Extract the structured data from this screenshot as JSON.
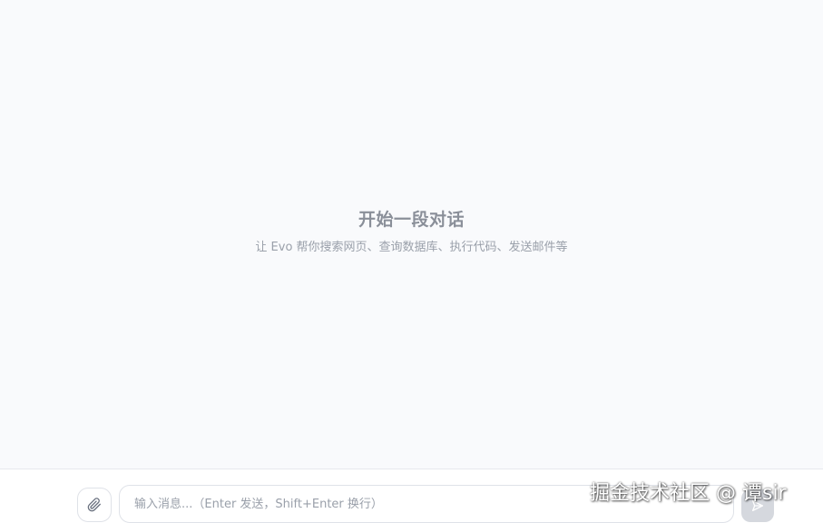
{
  "empty_state": {
    "title": "开始一段对话",
    "subtitle": "让 Evo 帮你搜索网页、查询数据库、执行代码、发送邮件等"
  },
  "composer": {
    "input_placeholder": "输入消息...（Enter 发送，Shift+Enter 换行）",
    "attach_icon": "paperclip-icon",
    "send_icon": "send-icon"
  },
  "watermark": {
    "text": "掘金技术社区 @ 谭sir"
  },
  "colors": {
    "background": "#f9fafc",
    "title": "#8a8f99",
    "subtitle": "#9aa0aa",
    "border": "#dfe2e8",
    "send_button": "#d5d8de"
  }
}
